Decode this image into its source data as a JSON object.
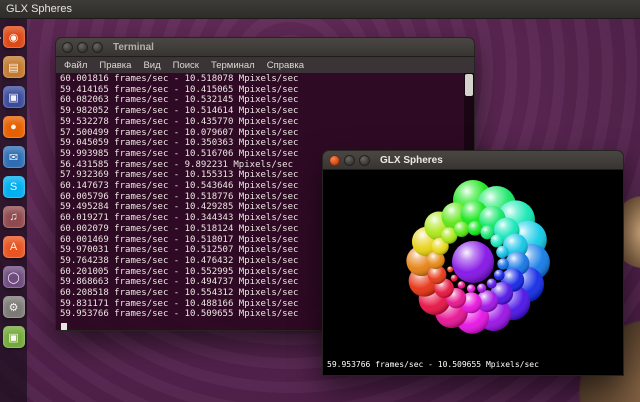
{
  "panel": {
    "title": "GLX Spheres"
  },
  "launcher": {
    "icons": [
      {
        "name": "ubuntu-dash",
        "color": "#DD4814",
        "glyph": "◉",
        "running": true
      },
      {
        "name": "files",
        "color": "#C17A2F",
        "glyph": "▤",
        "running": false
      },
      {
        "name": "libreoffice",
        "color": "#3B4B9B",
        "glyph": "▣",
        "running": false
      },
      {
        "name": "firefox",
        "color": "#E66000",
        "glyph": "●",
        "running": false
      },
      {
        "name": "email",
        "color": "#2F6DB3",
        "glyph": "✉",
        "running": false
      },
      {
        "name": "skype",
        "color": "#00AFF0",
        "glyph": "S",
        "running": false
      },
      {
        "name": "media-player",
        "color": "#8F4A4E",
        "glyph": "♫",
        "running": false
      },
      {
        "name": "software-center",
        "color": "#E95420",
        "glyph": "A",
        "running": false
      },
      {
        "name": "ubuntu-one",
        "color": "#6E4A7E",
        "glyph": "◯",
        "running": false
      },
      {
        "name": "system-settings",
        "color": "#7D7A76",
        "glyph": "⚙",
        "running": false
      },
      {
        "name": "green-app",
        "color": "#73A839",
        "glyph": "▣",
        "running": false
      }
    ]
  },
  "terminal": {
    "title": "Terminal",
    "menu": [
      "Файл",
      "Правка",
      "Вид",
      "Поиск",
      "Терминал",
      "Справка"
    ],
    "output_lines": [
      "60.001816 frames/sec - 10.518078 Mpixels/sec",
      "59.414165 frames/sec - 10.415065 Mpixels/sec",
      "60.082063 frames/sec - 10.532145 Mpixels/sec",
      "59.982052 frames/sec - 10.514614 Mpixels/sec",
      "59.532278 frames/sec - 10.435770 Mpixels/sec",
      "57.500499 frames/sec - 10.079607 Mpixels/sec",
      "59.045059 frames/sec - 10.350363 Mpixels/sec",
      "59.993985 frames/sec - 10.516706 Mpixels/sec",
      "56.431585 frames/sec - 9.892231 Mpixels/sec",
      "57.932369 frames/sec - 10.155313 Mpixels/sec",
      "60.147673 frames/sec - 10.543646 Mpixels/sec",
      "60.005796 frames/sec - 10.518776 Mpixels/sec",
      "59.495284 frames/sec - 10.429285 Mpixels/sec",
      "60.019271 frames/sec - 10.344343 Mpixels/sec",
      "60.002079 frames/sec - 10.518124 Mpixels/sec",
      "60.001469 frames/sec - 10.518017 Mpixels/sec",
      "59.970031 frames/sec - 10.512507 Mpixels/sec",
      "59.764238 frames/sec - 10.476432 Mpixels/sec",
      "60.201005 frames/sec - 10.552995 Mpixels/sec",
      "59.868663 frames/sec - 10.494737 Mpixels/sec",
      "60.208518 frames/sec - 10.554312 Mpixels/sec",
      "59.831171 frames/sec - 10.488166 Mpixels/sec",
      "59.953766 frames/sec - 10.509655 Mpixels/sec"
    ]
  },
  "glx": {
    "title": "GLX Spheres",
    "status": "59.953766 frames/sec - 10.509655 Mpixels/sec"
  },
  "theme": {
    "wallpaper": "#5E2750",
    "terminal_bg": "#300A24",
    "panel_bg": "#3C3B37",
    "close_button": "#E95420"
  }
}
